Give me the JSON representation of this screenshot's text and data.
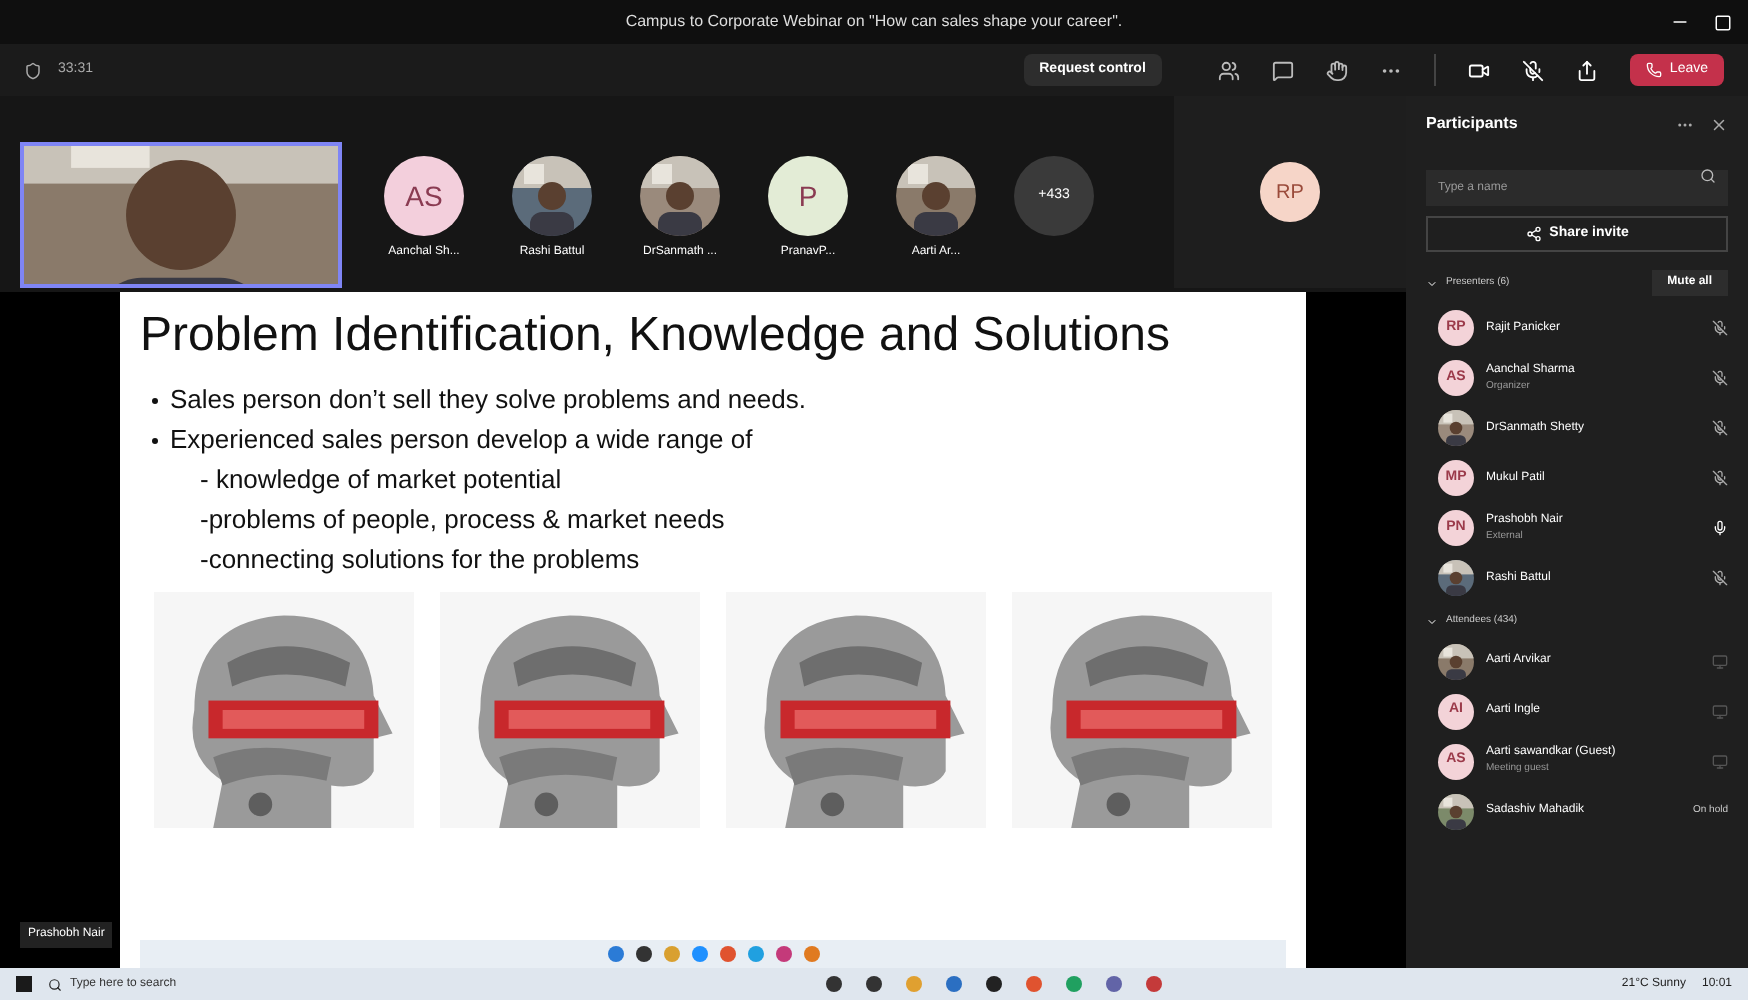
{
  "window": {
    "title": "Campus to Corporate Webinar on \"How can sales shape your career\"."
  },
  "toolbar": {
    "timer": "33:31",
    "request_control": "Request control",
    "leave": "Leave"
  },
  "strip": {
    "tiles": [
      {
        "name": "Aanchal Sh...",
        "kind": "initials",
        "initials": "AS",
        "color": "#f3cfdc"
      },
      {
        "name": "Rashi Battul",
        "kind": "picture"
      },
      {
        "name": "DrSanmath ...",
        "kind": "picture"
      },
      {
        "name": "PranavP...",
        "kind": "initials",
        "initials": "P",
        "color": "#e3ecd6"
      },
      {
        "name": "Aarti Ar...",
        "kind": "picture"
      }
    ],
    "overflow": "+433",
    "self_initials": "RP"
  },
  "slide": {
    "title": "Problem Identification, Knowledge and Solutions",
    "bullets": [
      "Sales person don’t sell they solve problems and needs.",
      "Experienced sales person develop a wide range of"
    ],
    "sub_items": [
      "- knowledge of market potential",
      "-problems of people, process & market needs",
      "-connecting solutions for the problems"
    ],
    "images": [
      {
        "kind": "picture"
      },
      {
        "kind": "picture"
      },
      {
        "kind": "picture"
      },
      {
        "kind": "picture"
      }
    ],
    "presenter_label": "Prashobh Nair"
  },
  "participants": {
    "title": "Participants",
    "search": {
      "placeholder": "Type a name"
    },
    "share_invite": "Share invite",
    "groups": [
      {
        "label": "Presenters (6)",
        "action": "Mute all",
        "people": [
          {
            "name": "Rajit Panicker",
            "initials": "RP",
            "muted": true
          },
          {
            "name": "Aanchal Sharma",
            "sub": "Organizer",
            "initials": "AS",
            "muted": true
          },
          {
            "name": "DrSanmath Shetty",
            "muted": true
          },
          {
            "name": "Mukul Patil",
            "initials": "MP",
            "muted": true
          },
          {
            "name": "Prashobh Nair",
            "sub": "External",
            "initials": "PN",
            "muted": false
          },
          {
            "name": "Rashi Battul",
            "muted": true
          }
        ]
      },
      {
        "label": "Attendees (434)",
        "people": [
          {
            "name": "Aarti Arvikar"
          },
          {
            "name": "Aarti Ingle",
            "initials": "AI"
          },
          {
            "name": "Aarti sawandkar (Guest)",
            "sub": "Meeting guest",
            "initials": "AS"
          },
          {
            "name": "Sadashiv Mahadik",
            "status": "On hold"
          }
        ]
      }
    ]
  },
  "taskbar": {
    "search_placeholder": "Type here to search",
    "weather": "21°C Sunny",
    "time": "10:01"
  }
}
